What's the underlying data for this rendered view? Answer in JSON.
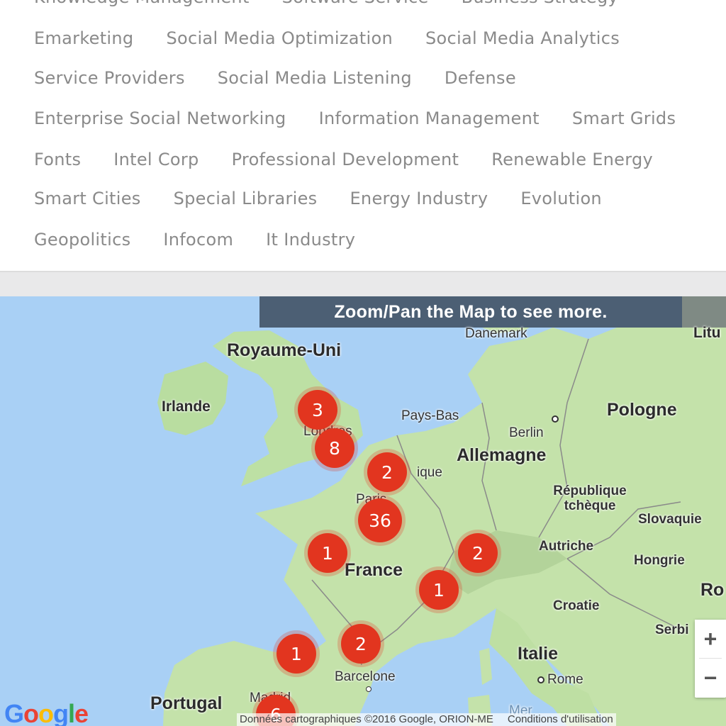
{
  "tags": {
    "rows": [
      [
        "Knowledge Management",
        "Software Service",
        "Business Strategy"
      ],
      [
        "Emarketing",
        "Social Media Optimization",
        "Social Media Analytics"
      ],
      [
        "Service Providers",
        "Social Media Listening",
        "Defense"
      ],
      [
        "Enterprise Social Networking",
        "Information Management",
        "Smart Grids"
      ],
      [
        "Fonts",
        "Intel Corp",
        "Professional Development",
        "Renewable Energy"
      ],
      [
        "Smart Cities",
        "Special Libraries",
        "Energy Industry",
        "Evolution"
      ],
      [
        "Geopolitics",
        "Infocom",
        "It Industry"
      ]
    ]
  },
  "map": {
    "banner": "Zoom/Pan the Map to see more.",
    "places": {
      "royaume_uni": "Royaume-Uni",
      "irlande": "Irlande",
      "danemark": "Danemark",
      "lituanie": "Litu",
      "pays_bas": "Pays-Bas",
      "berlin": "Berlin",
      "pologne": "Pologne",
      "allemagne": "Allemagne",
      "londres": "Londres",
      "belgique": "ique",
      "paris": "Paris",
      "republique_tcheque": "République tchèque",
      "slovaquie": "Slovaquie",
      "autriche": "Autriche",
      "hongrie": "Hongrie",
      "france": "France",
      "roumanie": "Ro",
      "croatie": "Croatie",
      "serbie": "Serbi",
      "italie": "Italie",
      "rome": "Rome",
      "barcelone": "Barcelone",
      "portugal": "Portugal",
      "madrid": "Madrid",
      "mer": "Mer"
    },
    "clusters": {
      "london_north": "3",
      "london": "8",
      "belgium": "2",
      "paris": "36",
      "western_france": "1",
      "switzerland": "2",
      "lyon": "1",
      "toulouse": "1",
      "montpellier": "2",
      "madrid": "6"
    },
    "zoom_in": "+",
    "zoom_out": "−",
    "logo": "Google",
    "attribution": "Données cartographiques ©2016 Google, ORION-ME",
    "terms": "Conditions d'utilisation"
  }
}
